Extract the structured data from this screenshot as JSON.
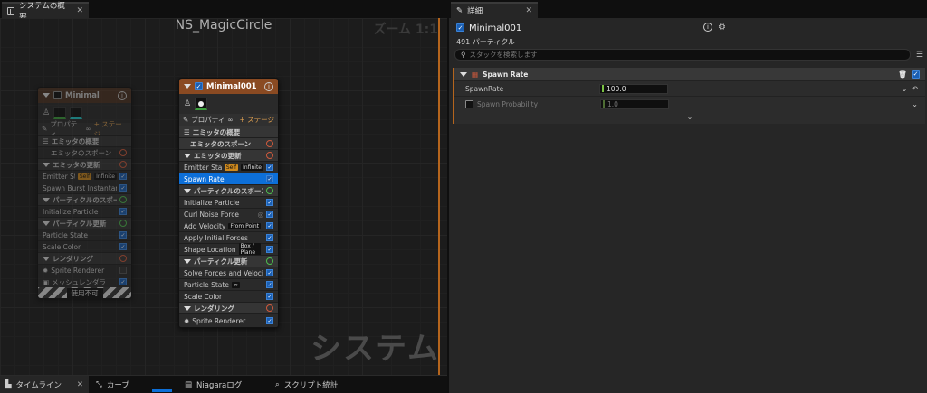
{
  "left_tab": {
    "title": "システムの概要",
    "close": "✕"
  },
  "graph": {
    "title": "NS_MagicCircle",
    "zoom": "ズーム 1:1",
    "watermark": "システム"
  },
  "disabled_emitter": {
    "name": "Minimal",
    "properties": "プロパティ",
    "stage": "ステージ",
    "rows": {
      "summary": "エミッタの概要",
      "spawn": "エミッタのスポーン",
      "update": "エミッタの更新",
      "emitter_state": "Emitter State",
      "badge_self": "Self",
      "badge_infinite": "Infinite",
      "spawn_burst": "Spawn Burst Instantaneous",
      "particle_spawn": "パーティクルのスポーン",
      "init_particle": "Initialize Particle",
      "particle_update": "パーティクル更新",
      "particle_state": "Particle State",
      "scale_color": "Scale Color",
      "render": "レンダリング",
      "sprite_renderer": "Sprite Renderer",
      "mesh_renderer": "メッシュレンダラ"
    },
    "disabled_label": "使用不可"
  },
  "emitter": {
    "name": "Minimal001",
    "properties": "プロパティ",
    "stage": "ステージ",
    "rows": {
      "summary": "エミッタの概要",
      "spawn": "エミッタのスポーン",
      "update": "エミッタの更新",
      "emitter_state": "Emitter State",
      "badge_self": "Self",
      "badge_infinite": "Infinite",
      "spawn_rate": "Spawn Rate",
      "particle_spawn": "パーティクルのスポーン",
      "init_particle": "Initialize Particle",
      "curl_noise": "Curl Noise Force",
      "add_velocity": "Add Velocity",
      "badge_from_point": "From Point",
      "apply_forces": "Apply Initial Forces",
      "shape_location": "Shape Location",
      "badge_box_plane": "Box / Plane",
      "particle_update": "パーティクル更新",
      "solve_forces": "Solve Forces and Velocity",
      "particle_state": "Particle State",
      "scale_color": "Scale Color",
      "render": "レンダリング",
      "sprite_renderer": "Sprite Renderer"
    }
  },
  "bottom_tabs": {
    "timeline": "タイムライン",
    "curve": "カーブ",
    "niagara_log": "Niagaraログ",
    "script_stats": "スクリプト統計",
    "close": "✕"
  },
  "details": {
    "tab": "詳細",
    "close": "✕",
    "emitter_name": "Minimal001",
    "particle_count": "491 パーティクル",
    "search_placeholder": "スタックを検索します",
    "section_title": "Spawn Rate",
    "spawn_rate_label": "SpawnRate",
    "spawn_rate_value": "100.0",
    "spawn_prob_label": "Spawn Probability",
    "spawn_prob_value": "1.0"
  },
  "colors": {
    "accent_orange": "#b5651d",
    "selection_blue": "#0d6fd8",
    "value_green": "#7ac143"
  }
}
